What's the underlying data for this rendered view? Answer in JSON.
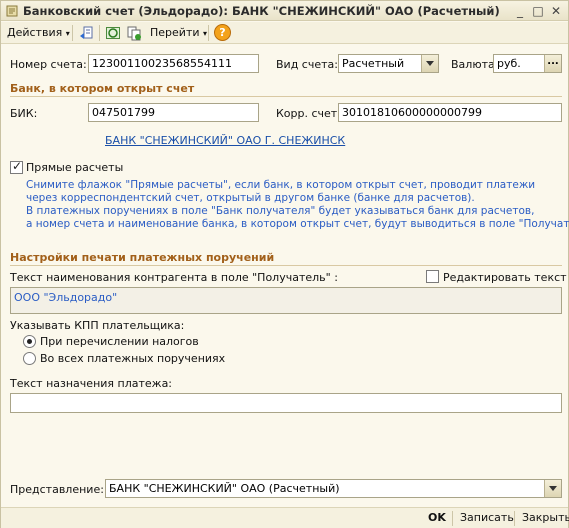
{
  "window": {
    "title": "Банковский счет (Эльдорадо): БАНК \"СНЕЖИНСКИЙ\" ОАО (Расчетный)",
    "minimize": "_",
    "maximize": "□",
    "close": "✕"
  },
  "toolbar": {
    "actions_label": "Действия",
    "goto_label": "Перейти",
    "help_label": "?"
  },
  "form": {
    "account_number_label": "Номер счета:",
    "account_number_value": "12300110023568554111",
    "account_type_label": "Вид счета:",
    "account_type_value": "Расчетный",
    "currency_label": "Валюта:",
    "currency_value": "руб.",
    "currency_button": "...",
    "bank_section": "Банк, в котором открыт счет",
    "bik_label": "БИК:",
    "bik_value": "047501799",
    "corr_label": "Корр. счет:",
    "corr_value": "30101810600000000799",
    "bank_link": "БАНК \"СНЕЖИНСКИЙ\" ОАО Г. СНЕЖИНСК",
    "direct_label": "Прямые расчеты",
    "direct_checked": true,
    "hint_lines": [
      "Снимите флажок \"Прямые расчеты\", если банк, в котором открыт счет, проводит платежи",
      "через корреспондентский счет, открытый в другом банке (банке для расчетов).",
      "В платежных поручениях в поле \"Банк получателя\" будет указываться банк для расчетов,",
      "а номер счета и наименование банка, в котором открыт счет, будут выводиться в поле \"Получатель\"."
    ],
    "print_section": "Настройки печати платежных поручений",
    "recipient_label": "Текст наименования контрагента в поле \"Получатель\" :",
    "edit_text_label": "Редактировать текст",
    "edit_text_checked": false,
    "recipient_value": "ООО \"Эльдорадо\"",
    "kpp_label": "Указывать КПП плательщика:",
    "radio_taxes": "При перечислении налогов",
    "radio_all": "Во всех платежных поручениях",
    "purpose_label": "Текст назначения платежа:",
    "purpose_value": "",
    "presentation_label": "Представление:",
    "presentation_value": "БАНК \"СНЕЖИНСКИЙ\" ОАО (Расчетный)"
  },
  "footer": {
    "ok_label": "OK",
    "save_label": "Записать",
    "close_label": "Закрыть"
  },
  "colors": {
    "background": "#fbf8ec",
    "section_text": "#a2601a",
    "hint_text": "#2a5cc4",
    "link_text": "#1a4fa8"
  }
}
